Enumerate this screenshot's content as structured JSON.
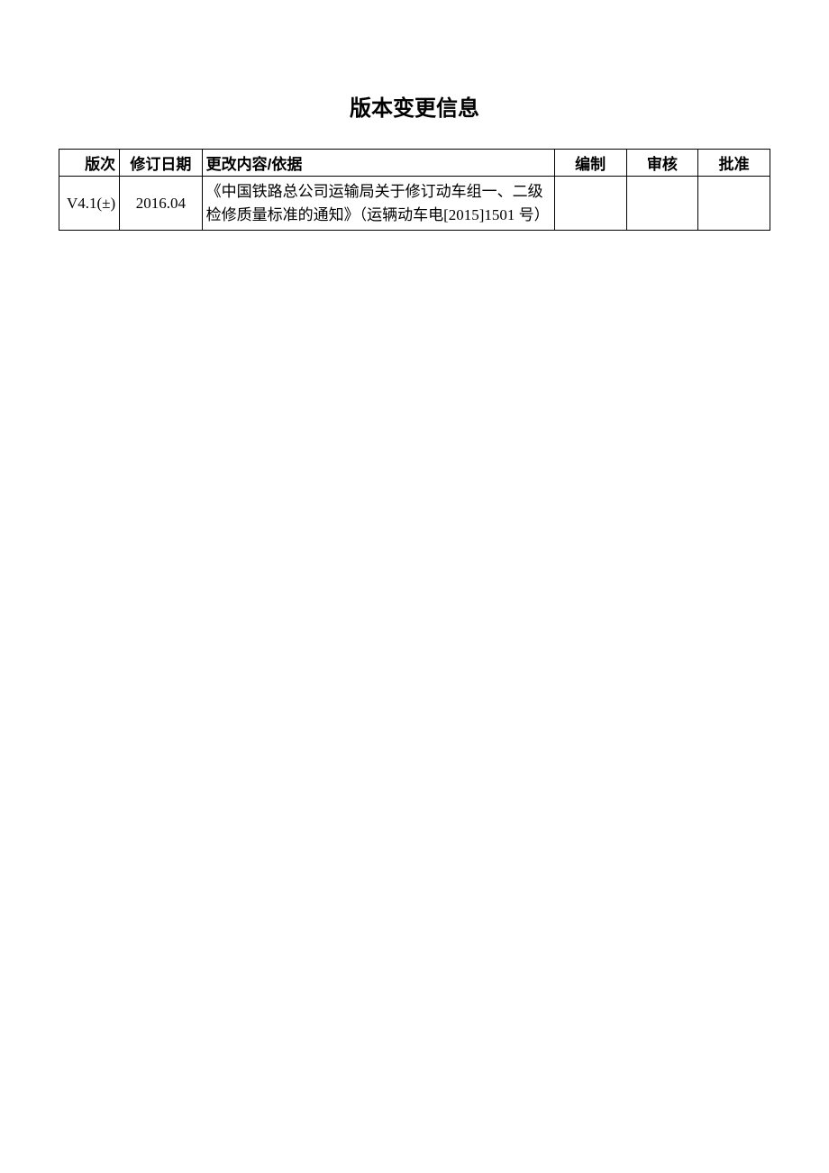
{
  "title": "版本变更信息",
  "table": {
    "headers": {
      "version": "版次",
      "date": "修订日期",
      "content": "更改内容/依据",
      "prepare": "编制",
      "review": "审核",
      "approve": "批准"
    },
    "rows": [
      {
        "version": "V4.1(±)",
        "date": "2016.04",
        "content": "《中国铁路总公司运输局关于修订动车组一、二级检修质量标准的通知》（运辆动车电[2015]1501 号）",
        "prepare": "",
        "review": "",
        "approve": ""
      }
    ]
  }
}
